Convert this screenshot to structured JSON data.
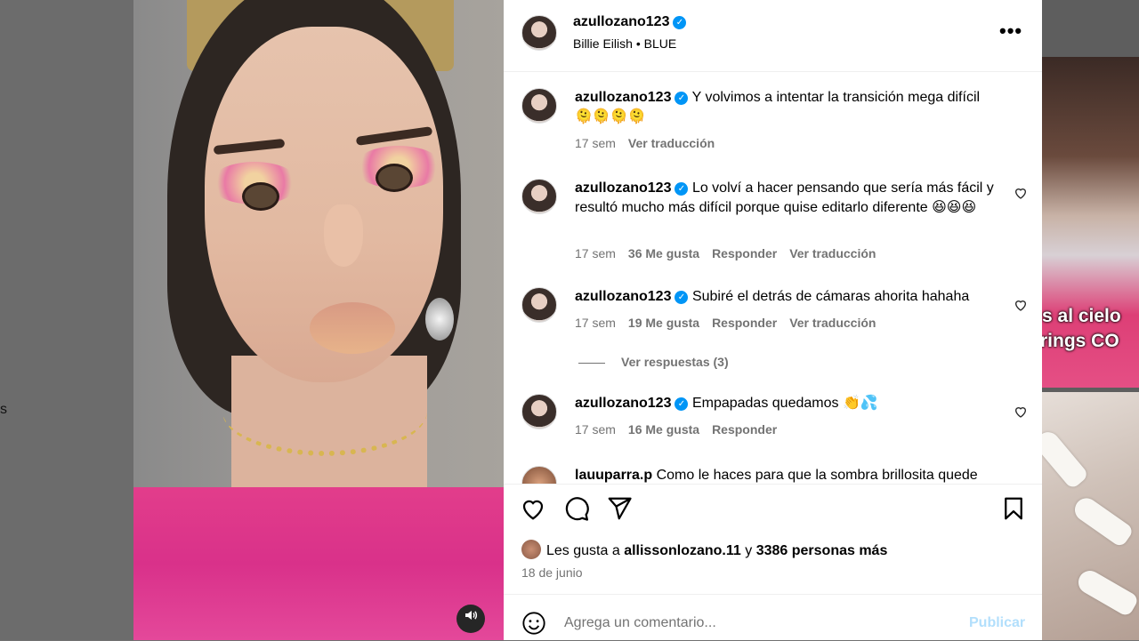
{
  "backdrop": {
    "left_fragment": "s",
    "right_thumb_overlay": [
      "s al cielo",
      "rings CO"
    ]
  },
  "post": {
    "username": "azullozano123",
    "audio_artist": "Billie Eilish",
    "audio_separator": "•",
    "audio_title": "BLUE",
    "more_label": "•••",
    "sound_icon": "speaker-icon"
  },
  "comments": [
    {
      "username": "azullozano123",
      "text": "Y volvimos a intentar la transición mega difícil 🫠🫠🫠🫠",
      "time": "17 sem",
      "likes": "",
      "reply": "",
      "translate": "Ver traducción"
    },
    {
      "username": "azullozano123",
      "text": "Lo volví a hacer pensando que sería más fácil y resultó mucho más difícil porque quise editarlo diferente 😆😆😆",
      "time": "17 sem",
      "likes": "36 Me gusta",
      "reply": "Responder",
      "translate": "Ver traducción"
    },
    {
      "username": "azullozano123",
      "text": "Subiré el detrás de cámaras ahorita hahaha",
      "time": "17 sem",
      "likes": "19 Me gusta",
      "reply": "Responder",
      "translate": "Ver traducción"
    },
    {
      "username": "azullozano123",
      "text": "Empapadas quedamos 👏💦",
      "time": "17 sem",
      "likes": "16 Me gusta",
      "reply": "Responder",
      "translate": ""
    },
    {
      "username": "lauuparra.p",
      "text": "Como le haces para que la sombra brillosita quede"
    }
  ],
  "view_replies": "Ver respuestas (3)",
  "likes_line": {
    "prefix": "Les gusta a",
    "user": "allissonlozano.11",
    "connector": "y",
    "others": "3386 personas más"
  },
  "date": "18 de junio",
  "add_comment": {
    "placeholder": "Agrega un comentario...",
    "publish": "Publicar"
  },
  "colors": {
    "verified": "#0095f6",
    "secondary_text": "#737373",
    "publish_disabled": "#b2dffc"
  }
}
